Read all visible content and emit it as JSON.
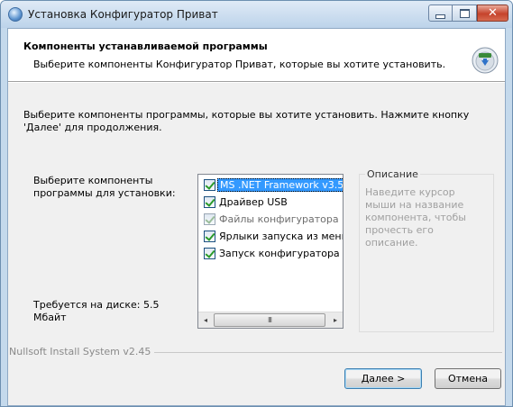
{
  "window": {
    "title": "Установка Конфигуратор Приват",
    "close_glyph": "✕"
  },
  "header": {
    "title": "Компоненты устанавливаемой программы",
    "subtitle": "Выберите компоненты Конфигуратор Приват, которые вы хотите установить."
  },
  "body": {
    "intro": "Выберите компоненты программы, которые вы хотите установить. Нажмите кнопку 'Далее' для продолжения.",
    "choose_label": "Выберите компоненты программы для установки:",
    "space_required": "Требуется на диске: 5.5 Мбайт"
  },
  "components": [
    {
      "label": "MS .NET Framework v3.5",
      "checked": true,
      "selected": true,
      "disabled": false
    },
    {
      "label": "Драйвер USB",
      "checked": true,
      "selected": false,
      "disabled": false
    },
    {
      "label": "Файлы конфигуратора",
      "checked": true,
      "selected": false,
      "disabled": true
    },
    {
      "label": "Ярлыки запуска из меню",
      "checked": true,
      "selected": false,
      "disabled": false
    },
    {
      "label": "Запуск конфигуратора",
      "checked": true,
      "selected": false,
      "disabled": false
    }
  ],
  "scrollbar": {
    "left_arrow": "◂",
    "right_arrow": "▸",
    "thumb_grip": "III"
  },
  "description": {
    "legend": "Описание",
    "text": "Наведите курсор мыши на название компонента, чтобы прочесть его описание."
  },
  "footer": {
    "branding": "Nullsoft Install System v2.45"
  },
  "buttons": {
    "next": "Далее >",
    "cancel": "Отмена"
  }
}
